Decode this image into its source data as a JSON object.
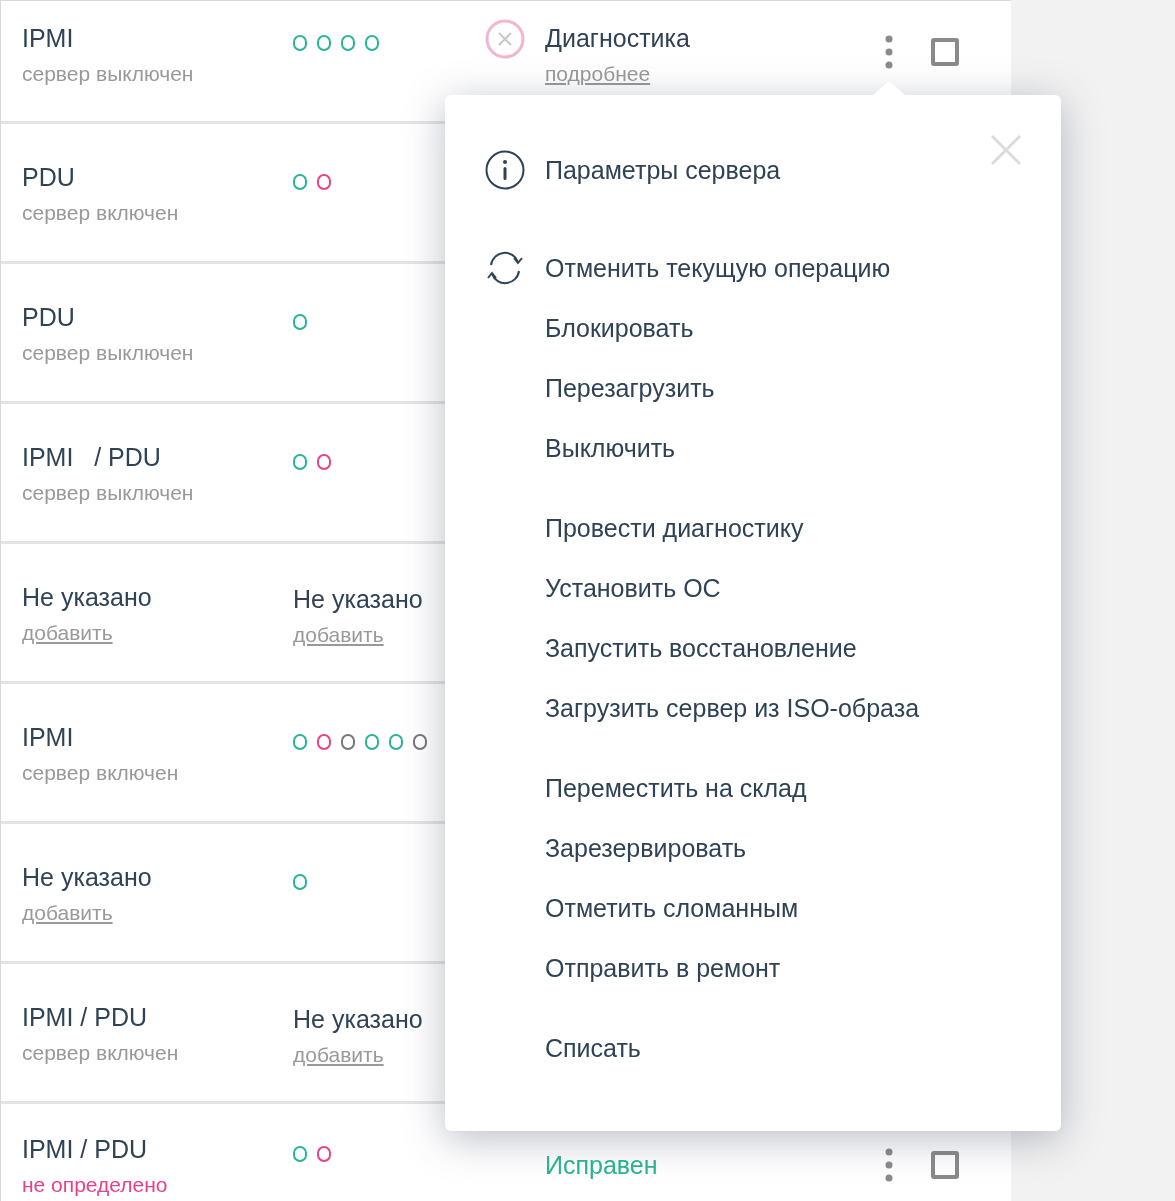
{
  "rows": [
    {
      "title": "IPMI",
      "subtitle": "сервер выключен",
      "kind": "text",
      "indicators": [
        {
          "color": "#2bb594"
        },
        {
          "color": "#2bb594"
        },
        {
          "color": "#2bb594"
        },
        {
          "color": "#2bb594"
        }
      ],
      "status": {
        "kind": "diagnostic",
        "title": "Диагностика",
        "link": "подробнее"
      },
      "checked": false
    },
    {
      "title": "PDU",
      "subtitle": "сервер включен",
      "kind": "text",
      "indicators": [
        {
          "color": "#2bb594"
        },
        {
          "color": "#e8418a"
        }
      ]
    },
    {
      "title": "PDU",
      "subtitle": "сервер выключен",
      "kind": "text",
      "indicators": [
        {
          "color": "#2bb594"
        }
      ]
    },
    {
      "title": "IPMI   / PDU",
      "subtitle": "сервер выключен",
      "kind": "text",
      "indicators": [
        {
          "color": "#2bb594"
        },
        {
          "color": "#e8418a"
        }
      ]
    },
    {
      "title": "Не указано",
      "subtitle": "добавить",
      "kind": "link",
      "column_2": {
        "title": "Не указано",
        "link": "добавить"
      }
    },
    {
      "title": "IPMI",
      "subtitle": "сервер включен",
      "kind": "text",
      "indicators": [
        {
          "color": "#2bb594"
        },
        {
          "color": "#e8418a"
        },
        {
          "color": "#777777"
        },
        {
          "color": "#2bb594"
        },
        {
          "color": "#2bb594"
        },
        {
          "color": "#777777"
        }
      ]
    },
    {
      "title": "Не указано",
      "subtitle": "добавить",
      "kind": "link",
      "indicators": [
        {
          "color": "#2bb594"
        }
      ]
    },
    {
      "title": "IPMI / PDU",
      "subtitle": "сервер включен",
      "kind": "text",
      "column_2": {
        "title": "Не указано",
        "link": "добавить"
      }
    },
    {
      "title": "IPMI / PDU",
      "subtitle": "не определено",
      "kind": "alert",
      "indicators": [
        {
          "color": "#2bb594"
        },
        {
          "color": "#e8418a"
        }
      ],
      "status": {
        "kind": "ok",
        "title": "Исправен"
      },
      "checked": false
    }
  ],
  "menu": {
    "groups": [
      [
        {
          "label": "Параметры сервера",
          "kind": "info"
        }
      ],
      [
        {
          "label": "Отменить текущую операцию",
          "kind": "refresh"
        },
        {
          "label": "Блокировать",
          "kind": "plain"
        },
        {
          "label": "Перезагрузить",
          "kind": "plain"
        },
        {
          "label": "Выключить",
          "kind": "plain"
        }
      ],
      [
        {
          "label": "Провести диагностику",
          "kind": "plain"
        },
        {
          "label": "Установить ОС",
          "kind": "plain"
        },
        {
          "label": "Запустить восстановление",
          "kind": "plain"
        },
        {
          "label": "Загрузить сервер из ISO-образа",
          "kind": "plain"
        }
      ],
      [
        {
          "label": "Переместить на склад",
          "kind": "plain"
        },
        {
          "label": "Зарезервировать",
          "kind": "plain"
        },
        {
          "label": "Отметить сломанным",
          "kind": "plain"
        },
        {
          "label": "Отправить в ремонт",
          "kind": "plain"
        }
      ],
      [
        {
          "label": "Списать",
          "kind": "plain"
        }
      ]
    ]
  }
}
